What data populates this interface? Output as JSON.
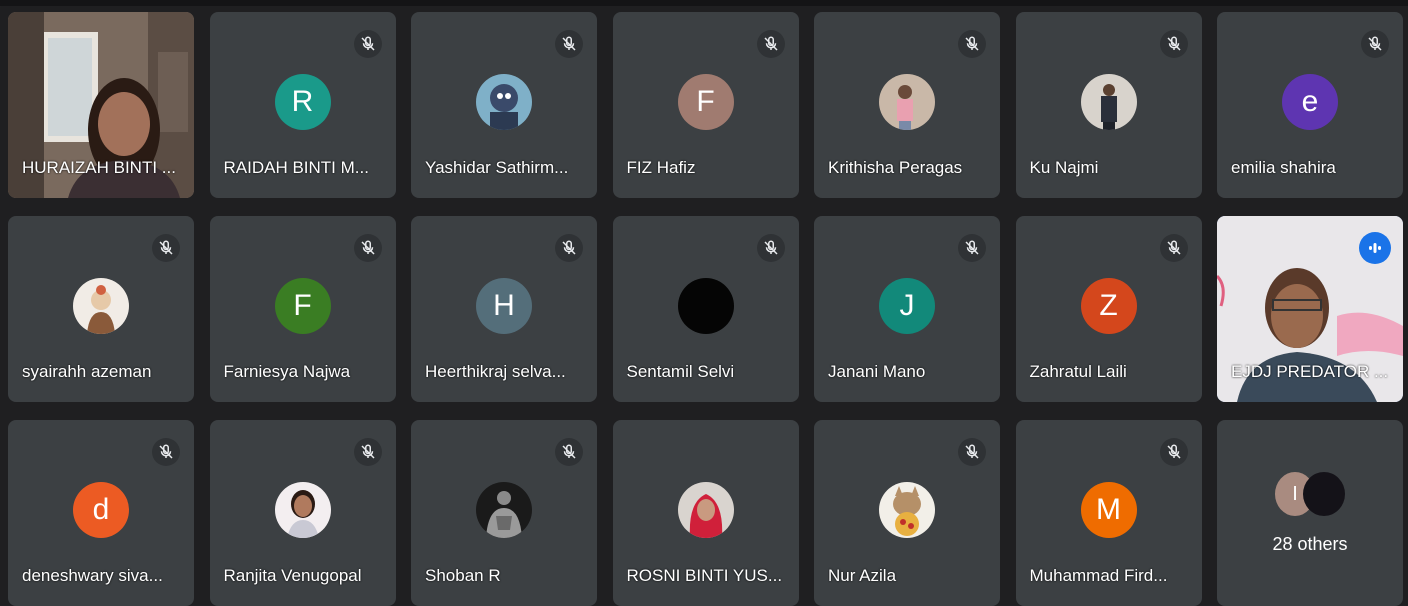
{
  "participants": [
    {
      "name": "HURAIZAH BINTI ...",
      "type": "video"
    },
    {
      "name": "RAIDAH BINTI M...",
      "type": "initial",
      "initial": "R",
      "color": "#1a9a8a",
      "muted": true
    },
    {
      "name": "Yashidar Sathirm...",
      "type": "photo",
      "muted": true
    },
    {
      "name": "FIZ Hafiz",
      "type": "initial",
      "initial": "F",
      "color": "#a07b70",
      "muted": true
    },
    {
      "name": "Krithisha Peragas",
      "type": "photo",
      "muted": true
    },
    {
      "name": "Ku Najmi",
      "type": "photo",
      "muted": true
    },
    {
      "name": "emilia shahira",
      "type": "initial",
      "initial": "e",
      "color": "#5e35b1",
      "muted": true
    },
    {
      "name": "syairahh azeman",
      "type": "photo",
      "muted": true
    },
    {
      "name": "Farniesya Najwa",
      "type": "initial",
      "initial": "F",
      "color": "#3a7d23",
      "muted": true
    },
    {
      "name": "Heerthikraj selva...",
      "type": "initial",
      "initial": "H",
      "color": "#546e7a",
      "muted": true
    },
    {
      "name": "Sentamil Selvi",
      "type": "photo",
      "muted": true
    },
    {
      "name": "Janani Mano",
      "type": "initial",
      "initial": "J",
      "color": "#12897a",
      "muted": true
    },
    {
      "name": "Zahratul Laili",
      "type": "initial",
      "initial": "Z",
      "color": "#d4471c",
      "muted": true
    },
    {
      "name": "EJDJ PREDATOR ...",
      "type": "video",
      "speaking": true
    },
    {
      "name": "deneshwary siva...",
      "type": "initial",
      "initial": "d",
      "color": "#ec5b23",
      "muted": true
    },
    {
      "name": "Ranjita Venugopal",
      "type": "photo",
      "muted": true
    },
    {
      "name": "Shoban R",
      "type": "photo",
      "muted": true
    },
    {
      "name": "ROSNI BINTI YUS...",
      "type": "photo",
      "muted": true
    },
    {
      "name": "Nur Azila",
      "type": "photo",
      "muted": true
    },
    {
      "name": "Muhammad Fird...",
      "type": "initial",
      "initial": "M",
      "color": "#ef6c00",
      "muted": true
    }
  ],
  "others": {
    "label": "28 others",
    "initial": "I"
  },
  "colors": {
    "tile_bg": "#3c4043",
    "page_bg": "#202124",
    "speaking_border": "#8ab4f8",
    "speaking_badge": "#1a73e8"
  }
}
